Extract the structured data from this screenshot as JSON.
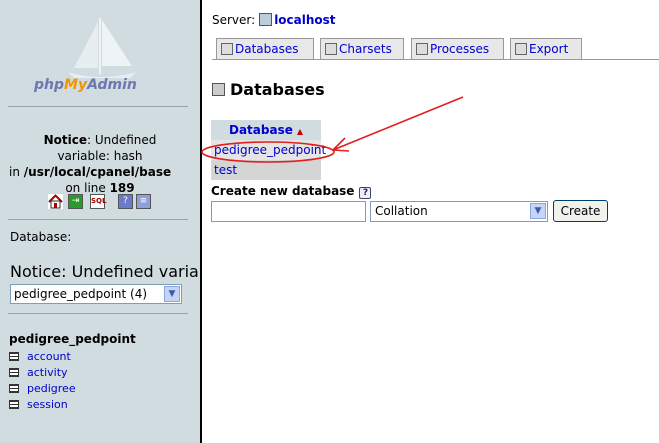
{
  "left": {
    "logo": {
      "php": "php",
      "my": "My",
      "admin": "Admin"
    },
    "notice": {
      "line1_bold": "Notice",
      "line1_rest": ": Undefined",
      "line2": "variable: hash",
      "line3_pre": "in ",
      "line3_path": "/usr/local/cpanel/base",
      "line4_pre": "on line ",
      "line4_num": "189"
    },
    "icons": [
      "home-icon",
      "exit-icon",
      "sql-icon",
      "help-icon",
      "docs-icon"
    ],
    "database_label": "Database:",
    "notice_big": "Notice: Undefined varia",
    "db_select_value": "pedigree_pedpoint (4)",
    "current_db": "pedigree_pedpoint",
    "tables": [
      "account",
      "activity",
      "pedigree",
      "session"
    ]
  },
  "right": {
    "server_label": "Server:",
    "server_name": "localhost",
    "tabs": [
      {
        "label": "Databases",
        "icon": "databases-icon"
      },
      {
        "label": "Charsets",
        "icon": "charsets-icon"
      },
      {
        "label": "Processes",
        "icon": "processes-icon"
      },
      {
        "label": "Export",
        "icon": "export-icon"
      }
    ],
    "page_title": "Databases",
    "table": {
      "header": "Database",
      "sort_indicator": "▲",
      "rows": [
        "pedigree_pedpoint",
        "test"
      ]
    },
    "create": {
      "label": "Create new database",
      "help": "?",
      "input_value": "",
      "collation_value": "Collation",
      "button": "Create"
    }
  },
  "colors": {
    "left_bg": "#d0dce0",
    "link": "#0000cc",
    "annotation": "#e02020"
  }
}
